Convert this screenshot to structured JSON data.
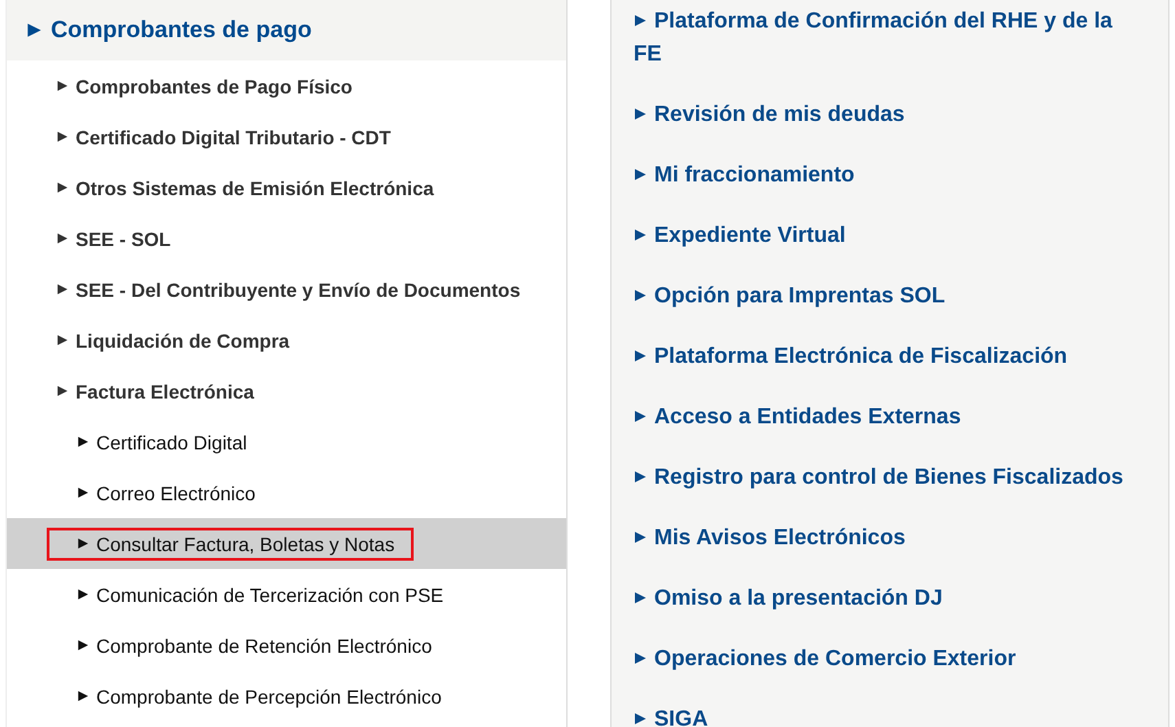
{
  "left_menu": {
    "title": "Comprobantes de pago",
    "items": [
      {
        "label": "Comprobantes de Pago Físico",
        "selected": false,
        "marked": false
      },
      {
        "label": "Certificado Digital Tributario - CDT",
        "selected": false,
        "marked": false
      },
      {
        "label": "Otros Sistemas de Emisión Electrónica",
        "selected": false,
        "marked": false
      },
      {
        "label": "SEE - SOL",
        "selected": false,
        "marked": false
      },
      {
        "label": "SEE - Del Contribuyente y Envío de Documentos",
        "selected": false,
        "marked": false
      },
      {
        "label": "Liquidación de Compra",
        "selected": false,
        "marked": false
      },
      {
        "label": "Factura Electrónica",
        "selected": false,
        "marked": false,
        "children": [
          {
            "label": "Certificado Digital",
            "selected": false,
            "marked": false
          },
          {
            "label": "Correo Electrónico",
            "selected": false,
            "marked": false
          },
          {
            "label": "Consultar Factura, Boletas y Notas",
            "selected": true,
            "marked": true
          },
          {
            "label": "Comunicación de Tercerización con PSE",
            "selected": false,
            "marked": false
          },
          {
            "label": "Comprobante de Retención Electrónico",
            "selected": false,
            "marked": false
          },
          {
            "label": "Comprobante de Percepción Electrónico",
            "selected": false,
            "marked": false
          }
        ]
      }
    ]
  },
  "right_menu": [
    "Plataforma de Confirmación del RHE y de la FE",
    "Revisión de mis deudas",
    "Mi fraccionamiento",
    "Expediente Virtual",
    "Opción para Imprentas SOL",
    "Plataforma Electrónica de Fiscalización",
    "Acceso a Entidades Externas",
    "Registro para control de Bienes Fiscalizados",
    "Mis Avisos Electrónicos",
    "Omiso a la presentación DJ",
    "Operaciones de Comercio Exterior",
    "SIGA"
  ]
}
